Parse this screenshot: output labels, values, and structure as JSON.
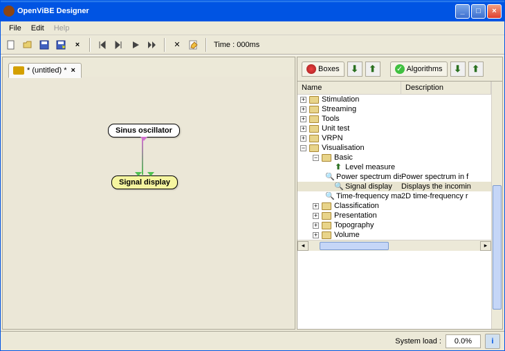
{
  "title": "OpenViBE Designer",
  "menu": {
    "file": "File",
    "edit": "Edit",
    "help": "Help"
  },
  "toolbar": {
    "time": "Time : 000ms"
  },
  "tab": {
    "label": "* (untitled) *"
  },
  "nodes": {
    "sinus": "Sinus oscillator",
    "signal": "Signal display"
  },
  "panel": {
    "boxes": "Boxes",
    "algorithms": "Algorithms",
    "cols": {
      "name": "Name",
      "desc": "Description"
    }
  },
  "tree": [
    {
      "indent": 0,
      "exp": "+",
      "type": "folder",
      "label": "Stimulation",
      "desc": ""
    },
    {
      "indent": 0,
      "exp": "+",
      "type": "folder",
      "label": "Streaming",
      "desc": ""
    },
    {
      "indent": 0,
      "exp": "+",
      "type": "folder",
      "label": "Tools",
      "desc": ""
    },
    {
      "indent": 0,
      "exp": "+",
      "type": "folder",
      "label": "Unit test",
      "desc": ""
    },
    {
      "indent": 0,
      "exp": "+",
      "type": "folder",
      "label": "VRPN",
      "desc": ""
    },
    {
      "indent": 0,
      "exp": "−",
      "type": "folder",
      "label": "Visualisation",
      "desc": ""
    },
    {
      "indent": 1,
      "exp": "−",
      "type": "folder",
      "label": "Basic",
      "desc": ""
    },
    {
      "indent": 2,
      "exp": "",
      "type": "up",
      "label": "Level measure",
      "desc": ""
    },
    {
      "indent": 2,
      "exp": "",
      "type": "mag",
      "label": "Power spectrum display",
      "desc": "Power spectrum in f"
    },
    {
      "indent": 2,
      "exp": "",
      "type": "mag",
      "label": "Signal display",
      "desc": "Displays the incomin",
      "selected": true
    },
    {
      "indent": 2,
      "exp": "",
      "type": "mag",
      "label": "Time-frequency map dis",
      "desc": "2D time-frequency r"
    },
    {
      "indent": 1,
      "exp": "+",
      "type": "folder",
      "label": "Classification",
      "desc": ""
    },
    {
      "indent": 1,
      "exp": "+",
      "type": "folder",
      "label": "Presentation",
      "desc": ""
    },
    {
      "indent": 1,
      "exp": "+",
      "type": "folder",
      "label": "Topography",
      "desc": ""
    },
    {
      "indent": 1,
      "exp": "+",
      "type": "folder",
      "label": "Volume",
      "desc": ""
    }
  ],
  "status": {
    "label": "System load :",
    "value": "0.0%"
  }
}
